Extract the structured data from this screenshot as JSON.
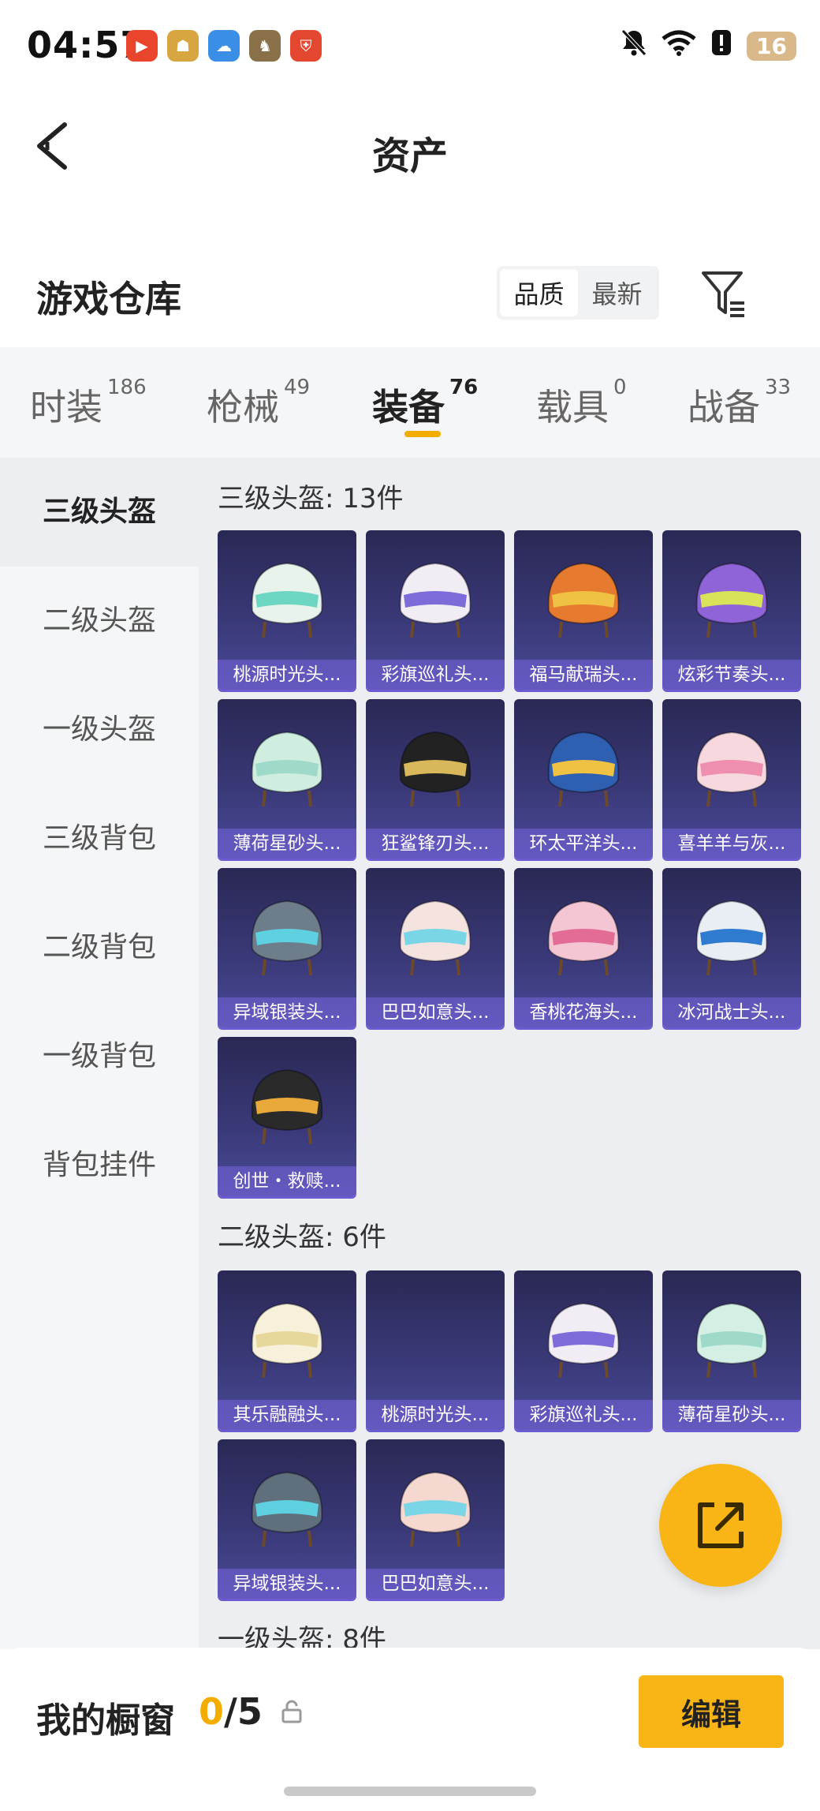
{
  "status": {
    "time": "04:57",
    "battery": "16",
    "apps": [
      {
        "icon": "video-app-icon",
        "color": "#e8452c",
        "glyph": "▶"
      },
      {
        "icon": "game-helper-app-icon",
        "color": "#d8a640",
        "glyph": "☗"
      },
      {
        "icon": "weather-app-icon",
        "color": "#3a8ee6",
        "glyph": "☁"
      },
      {
        "icon": "game-app-icon",
        "color": "#8a7048",
        "glyph": "♞"
      },
      {
        "icon": "security-app-icon",
        "color": "#e4472f",
        "glyph": "⛨"
      }
    ]
  },
  "header": {
    "title": "资产"
  },
  "warehouse": {
    "title": "游戏仓库",
    "sort": [
      "品质",
      "最新"
    ]
  },
  "tabs": [
    {
      "label": "时装",
      "count": "186"
    },
    {
      "label": "枪械",
      "count": "49"
    },
    {
      "label": "装备",
      "count": "76"
    },
    {
      "label": "载具",
      "count": "0"
    },
    {
      "label": "战备",
      "count": "33"
    }
  ],
  "sidebar": [
    "三级头盔",
    "二级头盔",
    "一级头盔",
    "三级背包",
    "二级背包",
    "一级背包",
    "背包挂件"
  ],
  "sections": [
    {
      "title": "三级头盔: 13件",
      "items": [
        {
          "name": "桃源时光头...",
          "color": "#e8f3ec",
          "accent": "#6dd6c2"
        },
        {
          "name": "彩旗巡礼头...",
          "color": "#f2ecf4",
          "accent": "#7c6bd8"
        },
        {
          "name": "福马献瑞头...",
          "color": "#e67a2e",
          "accent": "#f0c244"
        },
        {
          "name": "炫彩节奏头...",
          "color": "#8f64d9",
          "accent": "#d9e35a"
        },
        {
          "name": "薄荷星砂头...",
          "color": "#cfeee0",
          "accent": "#9fd9c9"
        },
        {
          "name": "狂鲨锋刃头...",
          "color": "#222222",
          "accent": "#d8b85a"
        },
        {
          "name": "环太平洋头...",
          "color": "#2f5fb0",
          "accent": "#f0c244"
        },
        {
          "name": "喜羊羊与灰...",
          "color": "#f6d8de",
          "accent": "#ee8fb0"
        },
        {
          "name": "异域银装头...",
          "color": "#6d7d8a",
          "accent": "#5fd0e0"
        },
        {
          "name": "巴巴如意头...",
          "color": "#f5e3e0",
          "accent": "#7ad6e6"
        },
        {
          "name": "香桃花海头...",
          "color": "#f4c6d4",
          "accent": "#e26c96"
        },
        {
          "name": "冰河战士头...",
          "color": "#e9eef5",
          "accent": "#2f7bd0"
        },
        {
          "name": "创世・救赎...",
          "color": "#2a2a2a",
          "accent": "#e9a93a"
        }
      ]
    },
    {
      "title": "二级头盔: 6件",
      "items": [
        {
          "name": "其乐融融头...",
          "color": "#f7f1dc",
          "accent": "#e8d79a"
        },
        {
          "name": "桃源时光头...",
          "color": "",
          "accent": ""
        },
        {
          "name": "彩旗巡礼头...",
          "color": "#f2ecf4",
          "accent": "#7c6bd8"
        },
        {
          "name": "薄荷星砂头...",
          "color": "#d4efe4",
          "accent": "#9fd9c9"
        },
        {
          "name": "异域银装头...",
          "color": "#5f6f7c",
          "accent": "#5fd0e0"
        },
        {
          "name": "巴巴如意头...",
          "color": "#f5d9d0",
          "accent": "#7ad6e6"
        }
      ]
    },
    {
      "title": "一级头盔: 8件",
      "items": []
    }
  ],
  "bottom": {
    "label": "我的橱窗",
    "current": "0",
    "total": "/5",
    "edit": "编辑"
  }
}
